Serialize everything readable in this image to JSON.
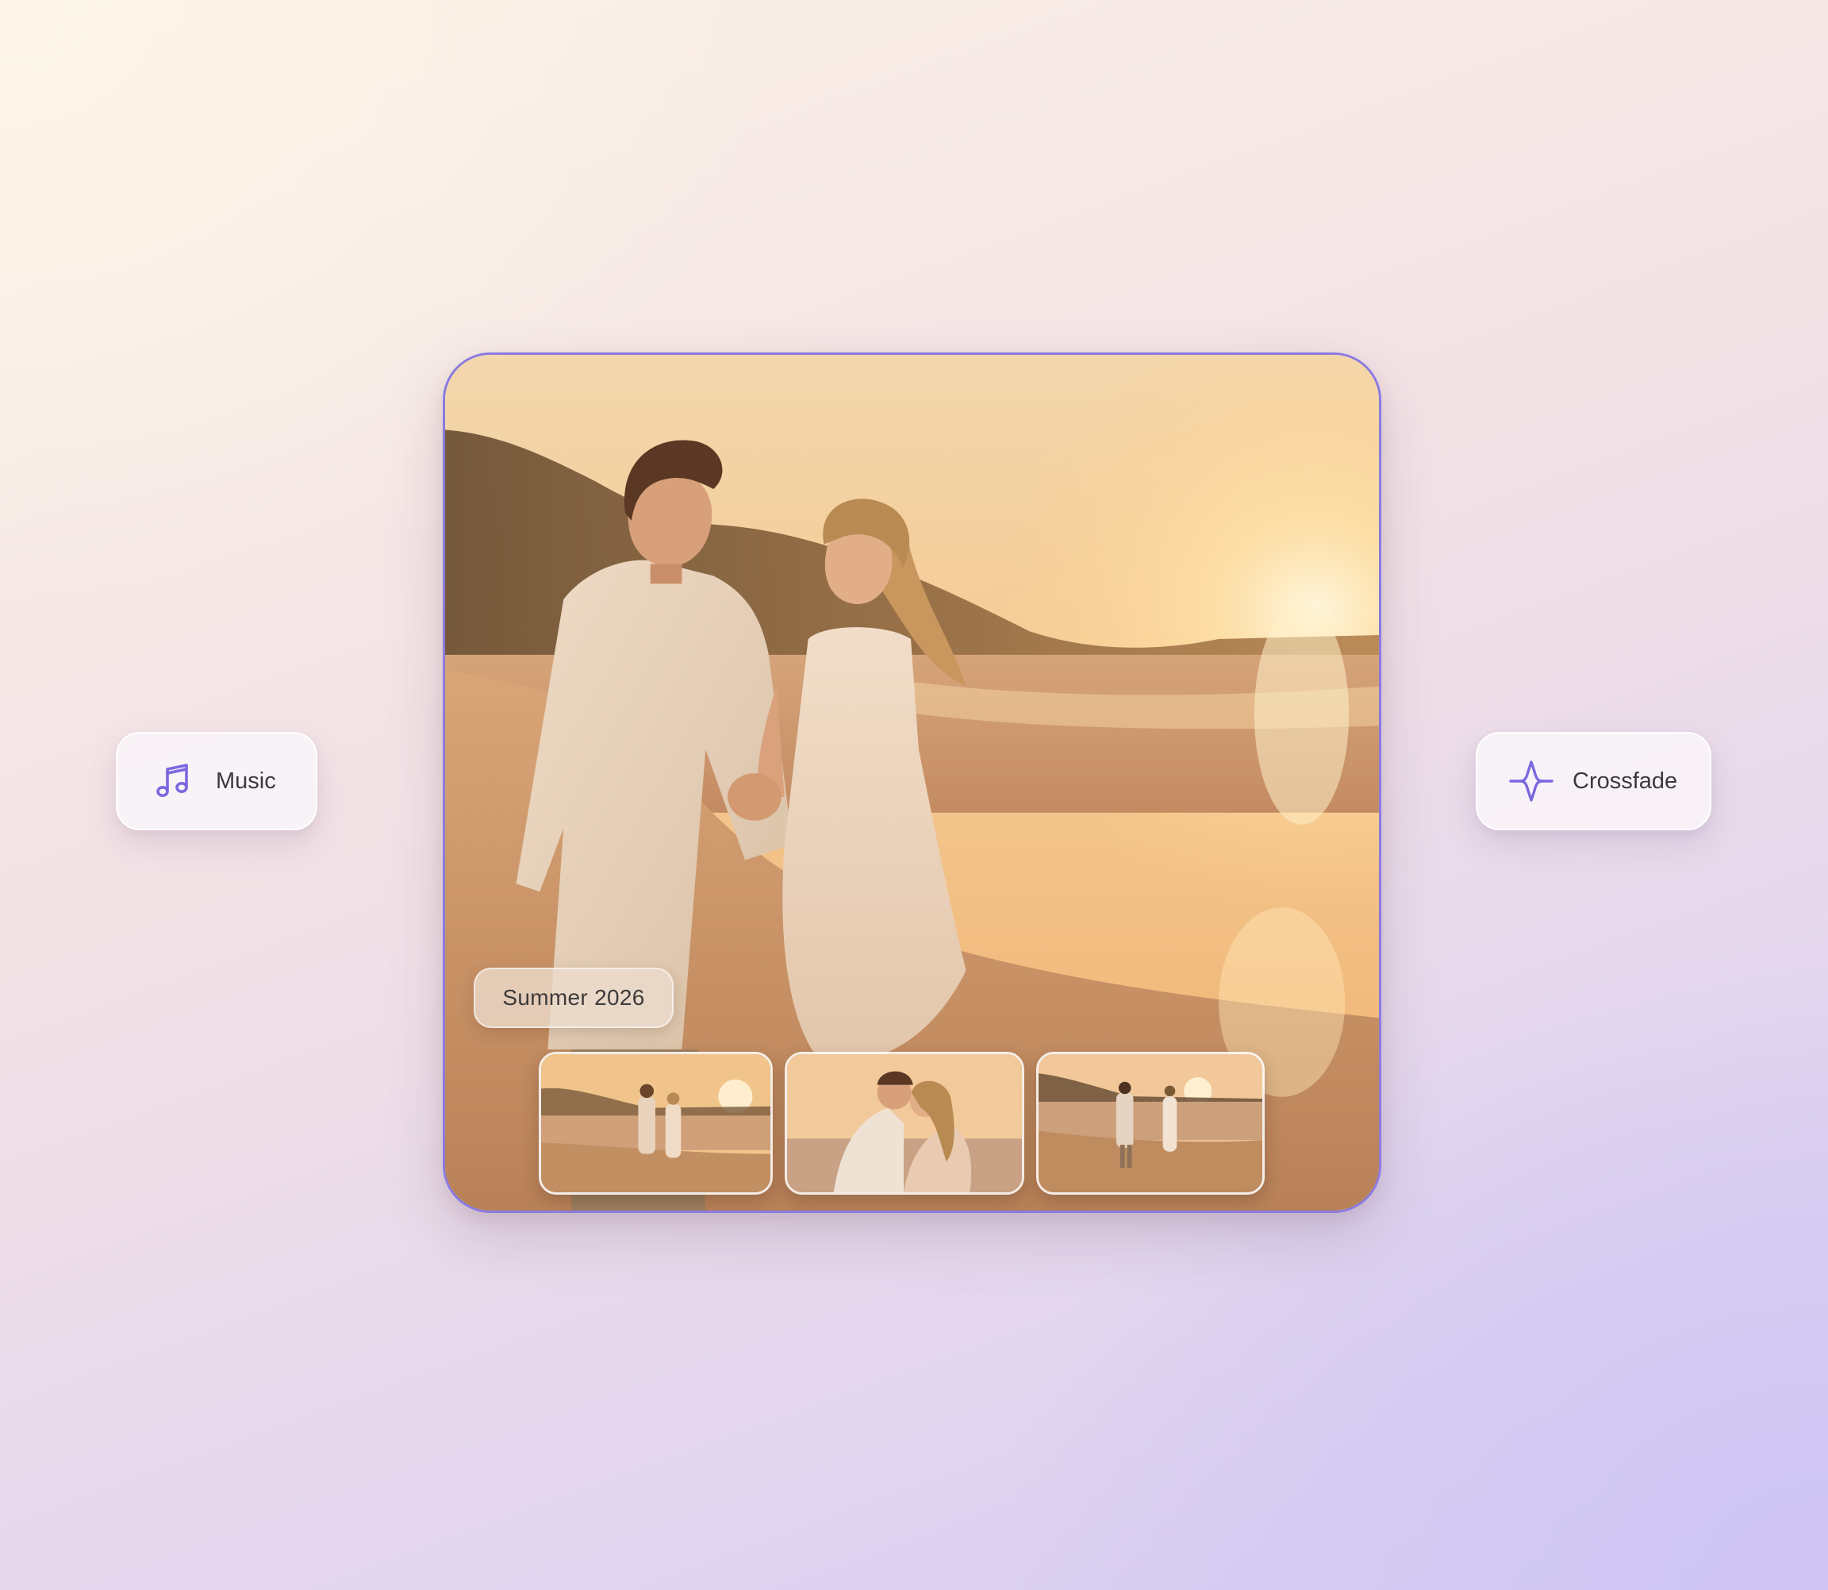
{
  "background": {
    "gradient_from": "#fbf1e6",
    "gradient_to": "#d4cbf3"
  },
  "accent_color": "#8a7ae0",
  "music_chip": {
    "icon": "music-note-icon",
    "label": "Music"
  },
  "crossfade_chip": {
    "icon": "crossfade-wave-icon",
    "label": "Crossfade"
  },
  "photo_card": {
    "album_tag": "Summer 2026",
    "thumbnails": [
      {
        "name": "thumbnail-couple-walking-beach"
      },
      {
        "name": "thumbnail-couple-embrace-sunset"
      },
      {
        "name": "thumbnail-couple-walking-away"
      }
    ]
  }
}
